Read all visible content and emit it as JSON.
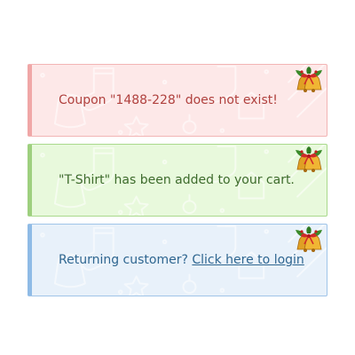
{
  "notices": [
    {
      "type": "error",
      "message": "Coupon \"1488-228\" does not exist!",
      "icon": "christmas-bells-icon",
      "color": "#b0413e",
      "background": "#fde8e8",
      "border": "#f0a7a7"
    },
    {
      "type": "success",
      "message": "\"T-Shirt\" has been added to your cart.",
      "icon": "christmas-bells-icon",
      "color": "#3d6b2c",
      "background": "#e8f9dc",
      "border": "#9ed07f"
    },
    {
      "type": "info",
      "message_prefix": "Returning customer?",
      "link_text": "Click here to login",
      "icon": "christmas-bells-icon",
      "color": "#2f6690",
      "background": "#e8f1fa",
      "border": "#8fbbe6"
    }
  ]
}
